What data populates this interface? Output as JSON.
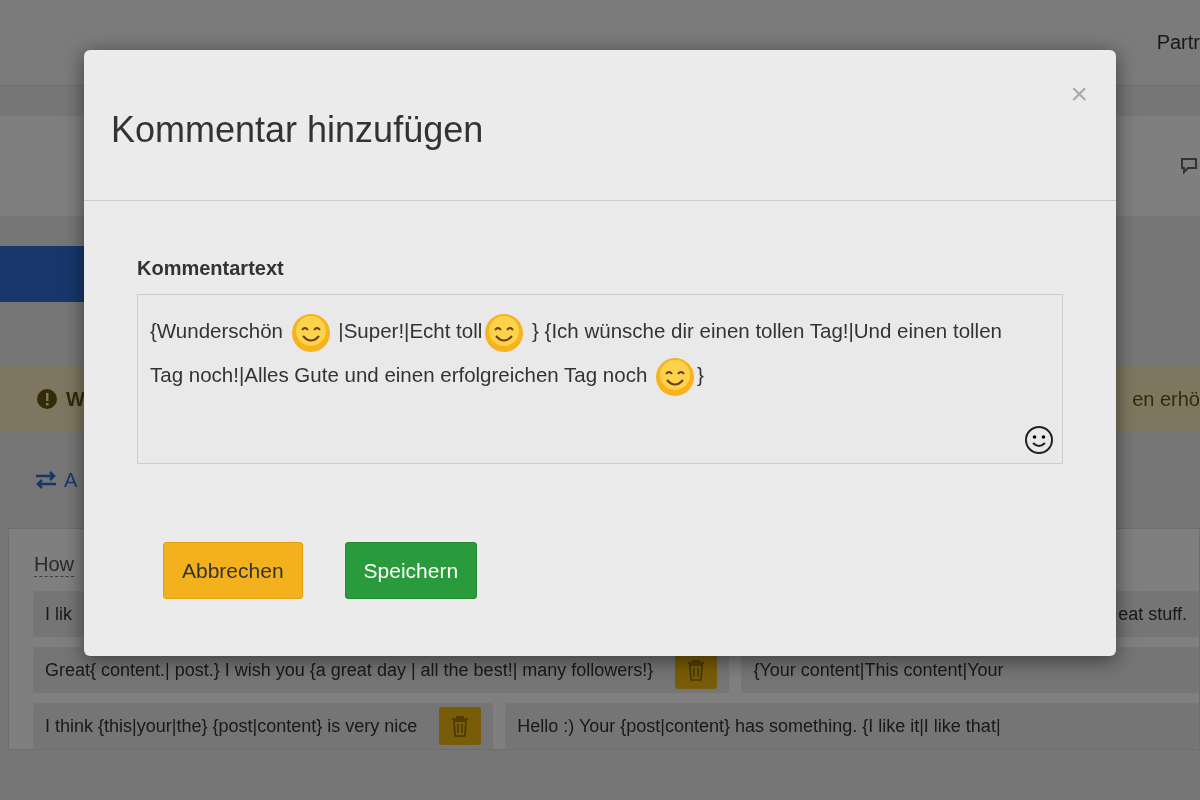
{
  "navbar": {
    "link": "Partr"
  },
  "warning": {
    "left": "W",
    "right": "en erhö"
  },
  "action_link": {
    "label": "A"
  },
  "card": {
    "heading": "How",
    "rows": [
      [
        {
          "text": "I lik",
          "trash": false
        },
        {
          "text": "eat stuff.",
          "trash": false
        }
      ],
      [
        {
          "text": "Great{ content.| post.} I wish you {a great day | all the best!| many followers!}",
          "trash": true
        },
        {
          "text": "{Your content|This content|Your",
          "trash": false
        }
      ],
      [
        {
          "text": "I think {this|your|the} {post|content} is very nice",
          "trash": true
        },
        {
          "text": "Hello :) Your {post|content} has something. {I like it|I like that|",
          "trash": false
        }
      ]
    ]
  },
  "dialog": {
    "title": "Kommentar hinzufügen",
    "close": "×",
    "field_label": "Kommentartext",
    "content": [
      {
        "kind": "text",
        "text": "{Wunderschön "
      },
      {
        "kind": "emoji"
      },
      {
        "kind": "text",
        "text": " |Super!|Echt toll"
      },
      {
        "kind": "emoji"
      },
      {
        "kind": "text",
        "text": " } {Ich wünsche dir einen tollen Tag!|Und einen tollen Tag noch!|Alles Gute und einen erfolgreichen Tag noch "
      },
      {
        "kind": "emoji"
      },
      {
        "kind": "text",
        "text": "}"
      }
    ],
    "buttons": [
      {
        "label": "Abbrechen",
        "kind": "warning"
      },
      {
        "label": "Speichern",
        "kind": "success"
      }
    ]
  }
}
